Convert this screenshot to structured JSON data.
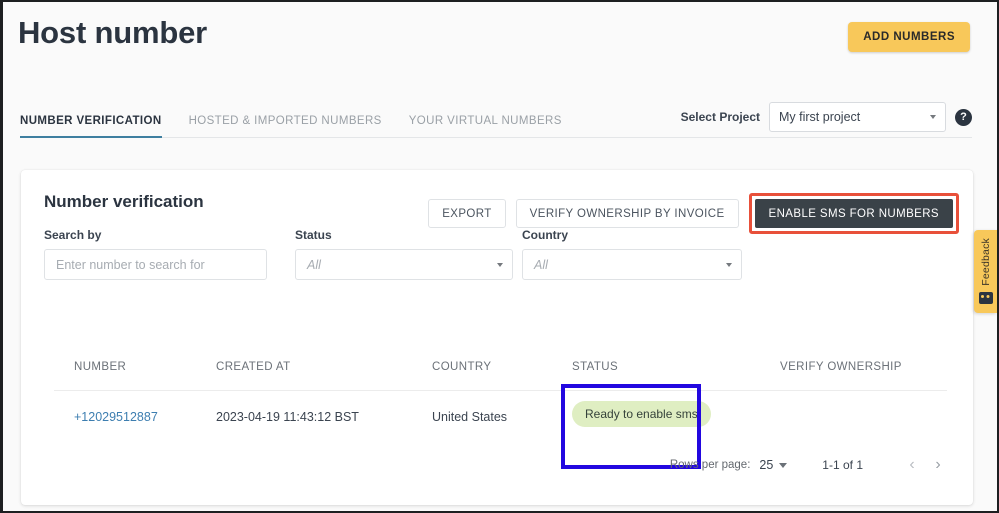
{
  "header": {
    "title": "Host number",
    "add_numbers_label": "ADD NUMBERS"
  },
  "tabs": [
    {
      "label": "NUMBER VERIFICATION",
      "active": true
    },
    {
      "label": "HOSTED & IMPORTED NUMBERS",
      "active": false
    },
    {
      "label": "YOUR VIRTUAL NUMBERS",
      "active": false
    }
  ],
  "project": {
    "label": "Select Project",
    "selected": "My first project",
    "help_icon": "help-circle-icon"
  },
  "card": {
    "title": "Number verification",
    "actions": {
      "export": "EXPORT",
      "verify_invoice": "VERIFY OWNERSHIP BY INVOICE",
      "enable_sms": "ENABLE SMS FOR NUMBERS"
    },
    "filters": {
      "search": {
        "label": "Search by",
        "value": "",
        "placeholder": "Enter number to search for"
      },
      "status": {
        "label": "Status",
        "value": "All"
      },
      "country": {
        "label": "Country",
        "value": "All"
      }
    },
    "table": {
      "columns": [
        "NUMBER",
        "CREATED AT",
        "COUNTRY",
        "STATUS",
        "VERIFY OWNERSHIP"
      ],
      "rows": [
        {
          "number": "+12029512887",
          "created_at": "2023-04-19 11:43:12 BST",
          "country": "United States",
          "status": "Ready to enable sms",
          "verify_ownership": ""
        }
      ]
    },
    "pagination": {
      "rows_per_page_label": "Rows per page:",
      "rows_per_page_value": "25",
      "range": "1-1 of 1",
      "prev_icon": "chevron-left-icon",
      "next_icon": "chevron-right-icon"
    }
  },
  "feedback": {
    "label": "Feedback",
    "icon": "feedback-camera-icon"
  },
  "annotations": {
    "enable_sms_highlight_color": "#e8503a",
    "status_highlight_color": "#2207e0"
  },
  "colors": {
    "accent_yellow": "#f8c85a",
    "dark_button": "#3a4248",
    "link_blue": "#3d7eb0",
    "chip_green_bg": "#dfeec2",
    "tab_underline": "#3e7fa0"
  }
}
